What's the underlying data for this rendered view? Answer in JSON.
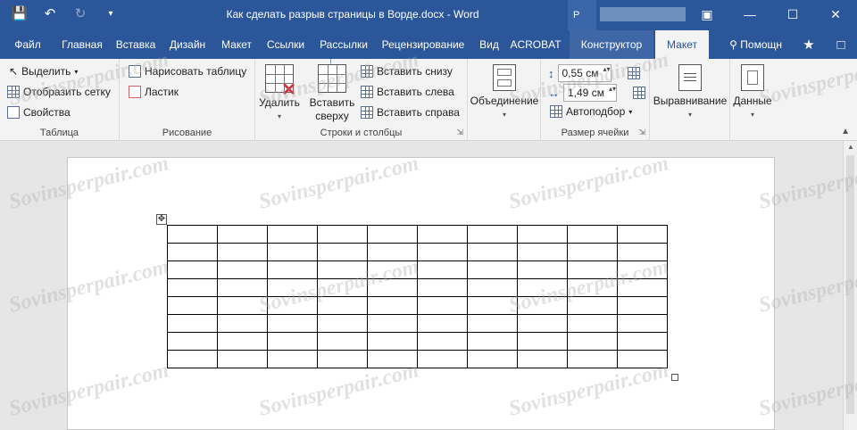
{
  "titlebar": {
    "title": "Как сделать разрыв страницы в Ворде.docx - Word",
    "account_initial": "Р"
  },
  "qat": {
    "save_icon": "save-icon",
    "undo_icon": "undo-icon",
    "redo_icon": "redo-icon",
    "customize_icon": "customize-qat-icon"
  },
  "tabs": {
    "file": "Файл",
    "home": "Главная",
    "insert": "Вставка",
    "design": "Дизайн",
    "layout": "Макет",
    "references": "Ссылки",
    "mailings": "Рассылки",
    "review": "Рецензирование",
    "view": "Вид",
    "acrobat": "ACROBAT",
    "table_design": "Конструктор",
    "table_layout": "Макет",
    "help": "Помощн"
  },
  "ribbon": {
    "table_group": {
      "select": "Выделить",
      "view_gridlines": "Отобразить сетку",
      "properties": "Свойства",
      "label": "Таблица"
    },
    "draw_group": {
      "draw_table": "Нарисовать таблицу",
      "eraser": "Ластик",
      "label": "Рисование"
    },
    "rows_cols_group": {
      "delete": "Удалить",
      "insert_above_line1": "Вставить",
      "insert_above_line2": "сверху",
      "insert_below": "Вставить снизу",
      "insert_left": "Вставить слева",
      "insert_right": "Вставить справа",
      "label": "Строки и столбцы"
    },
    "merge_group": {
      "merge": "Объединение"
    },
    "cell_size_group": {
      "height": "0,55 см",
      "width": "1,49 см",
      "autofit": "Автоподбор",
      "label": "Размер ячейки"
    },
    "alignment": "Выравнивание",
    "data": "Данные"
  },
  "document": {
    "table_rows": 8,
    "table_cols": 10
  },
  "watermark": "Sovinsperpair.com",
  "colors": {
    "accent": "#2b579a",
    "ribbon_bg": "#f3f3f3"
  }
}
